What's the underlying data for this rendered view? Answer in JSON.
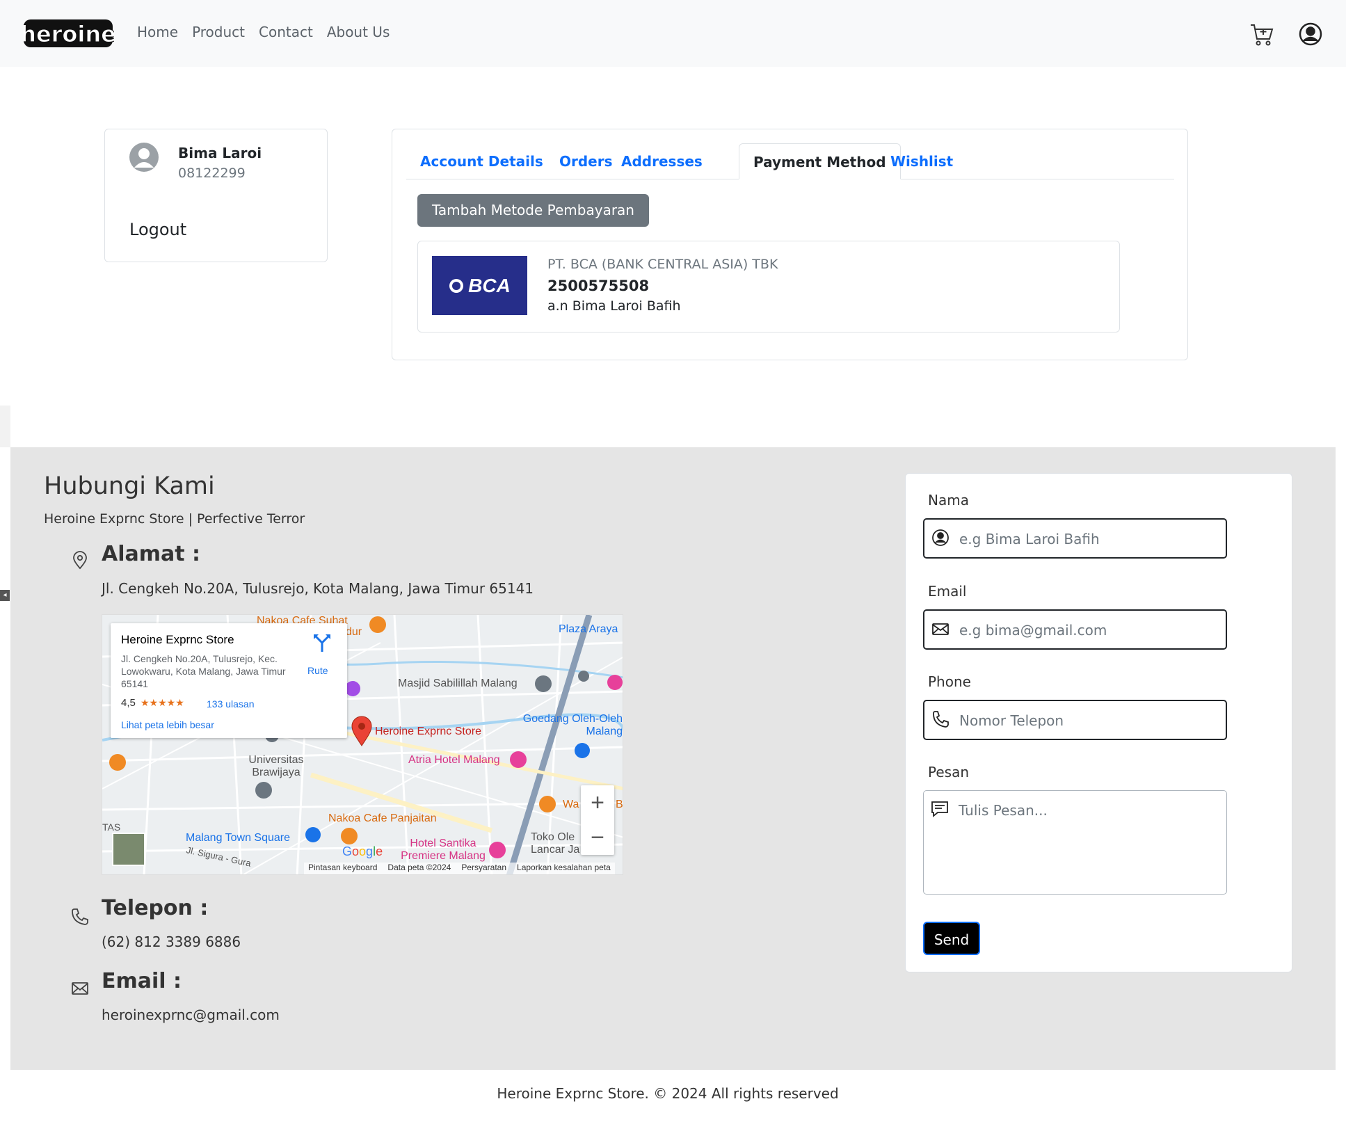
{
  "navbar": {
    "logo_text": "heroine",
    "links": [
      "Home",
      "Product",
      "Contact",
      "About Us"
    ],
    "cart_icon": "cart-plus-icon",
    "user_icon": "user-circle-icon"
  },
  "profile": {
    "name": "Bima Laroi",
    "phone": "08122299",
    "logout": "Logout"
  },
  "account": {
    "tabs": [
      "Account Details",
      "Orders",
      "Addresses",
      "Payment Method",
      "Wishlist"
    ],
    "active_tab": "Payment Method",
    "add_button": "Tambah Metode Pembayaran",
    "payment": {
      "logo_text": "BCA",
      "bank_name": "PT. BCA (BANK CENTRAL ASIA) TBK",
      "account_number": "2500575508",
      "account_holder": "a.n Bima Laroi Bafih"
    }
  },
  "contact": {
    "title": "Hubungi Kami",
    "subtitle": "Heroine Exprnc Store | Perfective Terror",
    "address_heading": "Alamat :",
    "address_value": "Jl. Cengkeh No.20A, Tulusrejo, Kota Malang, Jawa Timur 65141",
    "phone_heading": "Telepon :",
    "phone_value": "(62) 812 3389 6886",
    "email_heading": "Email :",
    "email_value": "heroinexprnc@gmail.com"
  },
  "map": {
    "popup_title": "Heroine Exprnc Store",
    "popup_address": "Jl. Cengkeh No.20A, Tulusrejo, Kec. Lowokwaru, Kota Malang, Jawa Timur 65141",
    "rating": "4,5",
    "stars": "★★★★★",
    "reviews": "133 ulasan",
    "larger_map": "Lihat peta lebih besar",
    "route": "Rute",
    "labels": {
      "nakoa_suhat": "Nakoa Cafe Suhat",
      "plaza_araya": "Plaza Araya",
      "masjid": "Masjid Sabilillah Malang",
      "goedang": "Goedang Oleh-Oleh Malang",
      "store": "Heroine Exprnc Store",
      "atria": "Atria Hotel Malang",
      "universitas": "Universitas Brawijaya",
      "nakoa_panjaitan": "Nakoa Cafe Panjaitan",
      "malang_town": "Malang Town Square",
      "hotel_santika": "Hotel Santika Premiere Malang",
      "toko": "Toko Ole Lancar Ja",
      "sigura": "Jl. Sigura - Gura",
      "tas": "TAS",
      "dur": "dur",
      "wa": "Wa",
      "b": "B"
    },
    "zoom_in": "+",
    "zoom_out": "−",
    "google": "Google",
    "footer": [
      "Pintasan keyboard",
      "Data peta ©2024",
      "Persyaratan",
      "Laporkan kesalahan peta"
    ]
  },
  "form": {
    "name_label": "Nama",
    "name_placeholder": "e.g Bima Laroi Bafih",
    "email_label": "Email",
    "email_placeholder": "e.g bima@gmail.com",
    "phone_label": "Phone",
    "phone_placeholder": "Nomor Telepon",
    "message_label": "Pesan",
    "message_placeholder": "Tulis Pesan...",
    "send": "Send"
  },
  "footer": {
    "text": "Heroine Exprnc Store. © 2024 All rights reserved"
  }
}
